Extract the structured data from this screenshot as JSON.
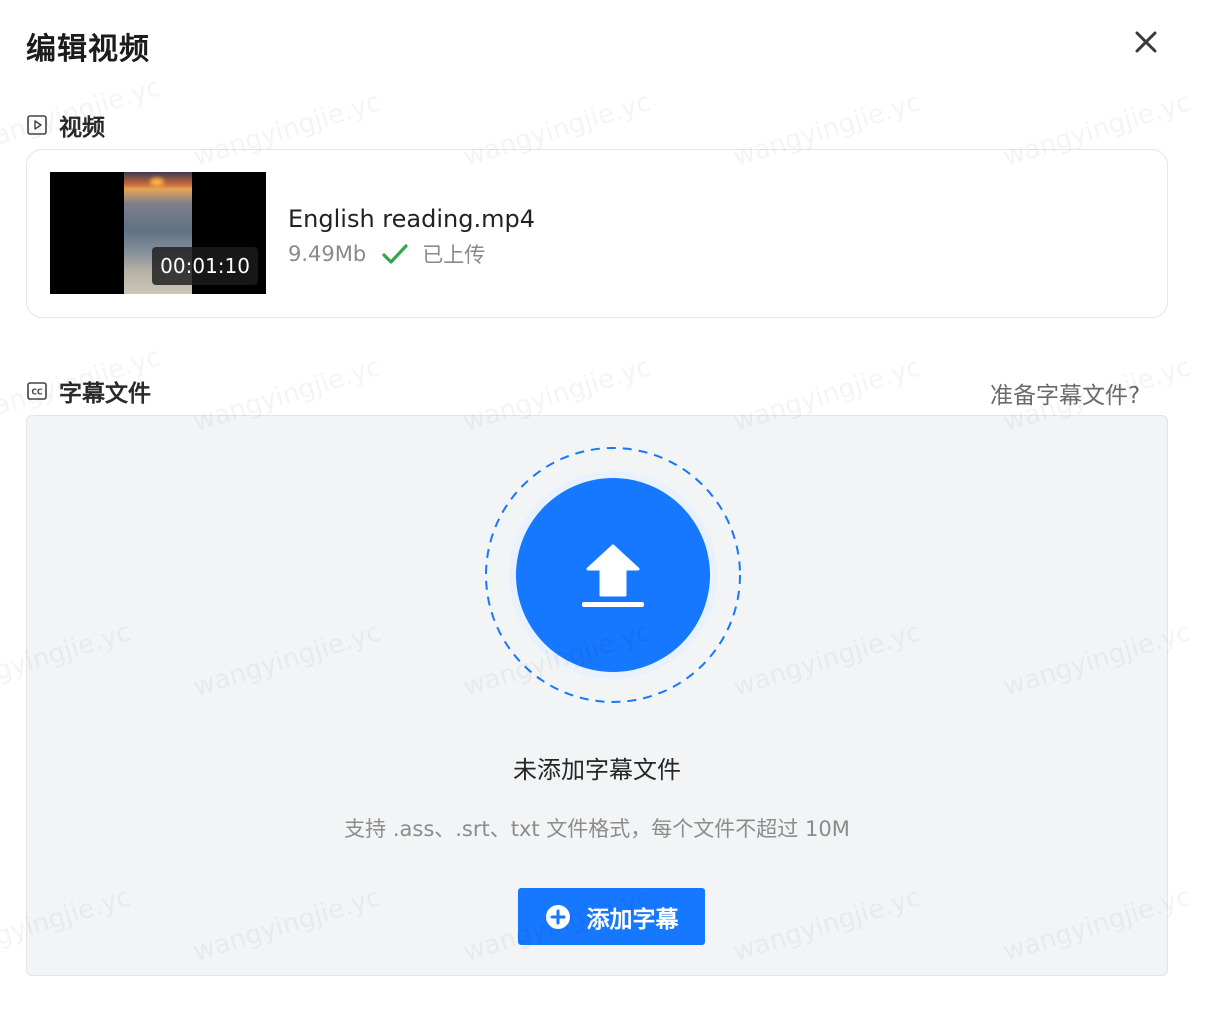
{
  "dialog": {
    "title": "编辑视频",
    "close_icon": "close-icon"
  },
  "video_section": {
    "title": "视频",
    "icon": "play-square-icon",
    "card": {
      "duration": "00:01:10",
      "file_name": "English reading.mp4",
      "file_size": "9.49Mb",
      "status": "已上传",
      "status_color": "#2ea84a"
    }
  },
  "subtitle_section": {
    "title": "字幕文件",
    "icon": "cc-icon",
    "help_link": "准备字幕文件?",
    "dropzone": {
      "upload_icon": "upload-icon",
      "empty_text": "未添加字幕文件",
      "format_hint": "支持 .ass、.srt、txt 文件格式，每个文件不超过 10M",
      "add_button": "添加字幕",
      "accent_color": "#1677ff"
    }
  },
  "watermark": "wangyingjie.yc"
}
